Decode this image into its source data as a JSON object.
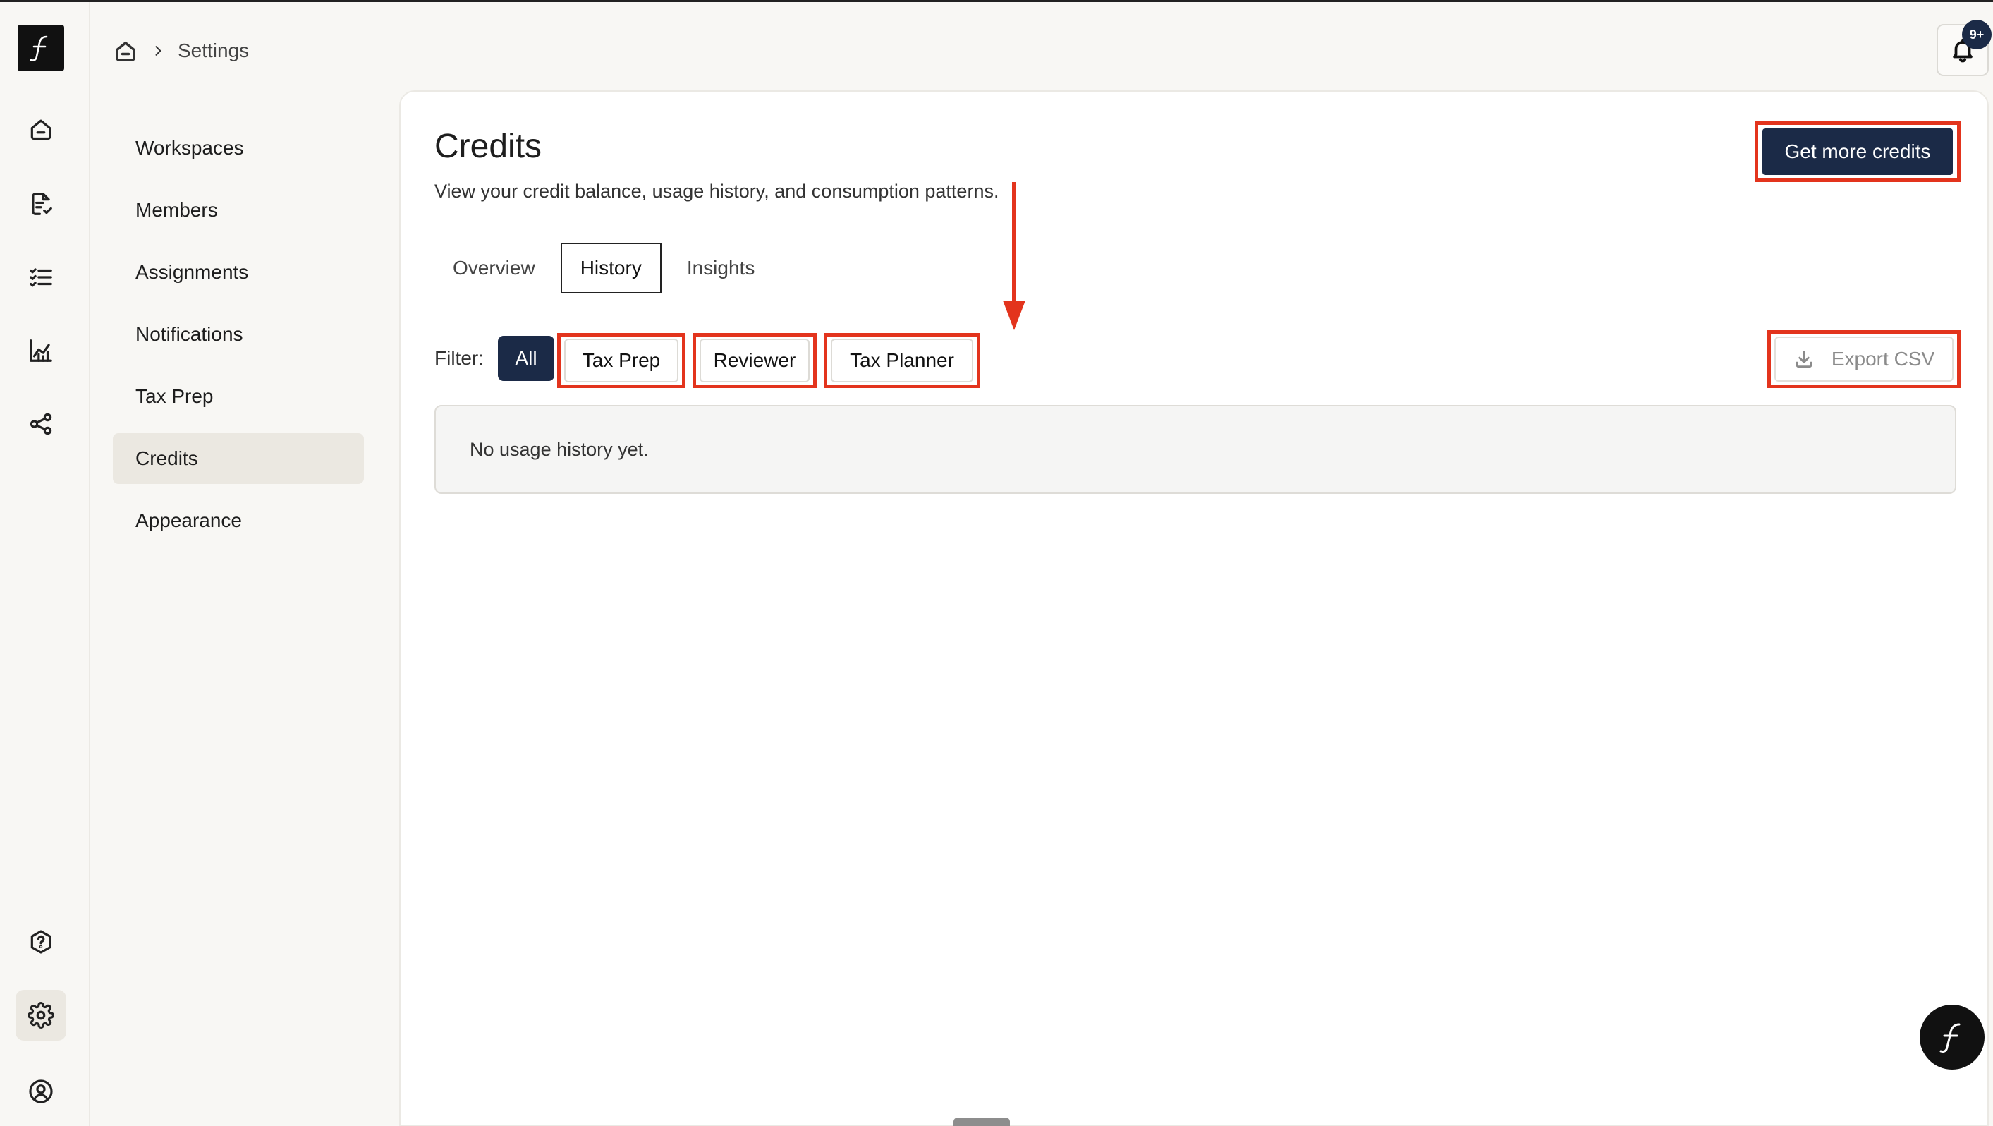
{
  "breadcrumb": {
    "current": "Settings"
  },
  "settings_nav": {
    "items": [
      {
        "label": "Workspaces"
      },
      {
        "label": "Members"
      },
      {
        "label": "Assignments"
      },
      {
        "label": "Notifications"
      },
      {
        "label": "Tax Prep"
      },
      {
        "label": "Credits",
        "active": true
      },
      {
        "label": "Appearance"
      }
    ]
  },
  "notifications": {
    "badge": "9+"
  },
  "page": {
    "title": "Credits",
    "subtitle": "View your credit balance, usage history, and consumption patterns.",
    "primary_button": "Get more credits"
  },
  "tabs": [
    {
      "label": "Overview"
    },
    {
      "label": "History",
      "active": true
    },
    {
      "label": "Insights"
    }
  ],
  "filters": {
    "label": "Filter:",
    "all": "All",
    "options": [
      "Tax Prep",
      "Reviewer",
      "Tax Planner"
    ]
  },
  "export": {
    "label": "Export CSV"
  },
  "history": {
    "empty_message": "No usage history yet."
  },
  "icons": {
    "rail": [
      "home-icon",
      "document-check-icon",
      "checklist-icon",
      "chart-icon",
      "share-icon",
      "help-icon",
      "settings-icon",
      "account-icon"
    ],
    "logo": "brand-f-logo"
  },
  "colors": {
    "navy": "#1b2a47",
    "annotation_red": "#e3341d"
  }
}
